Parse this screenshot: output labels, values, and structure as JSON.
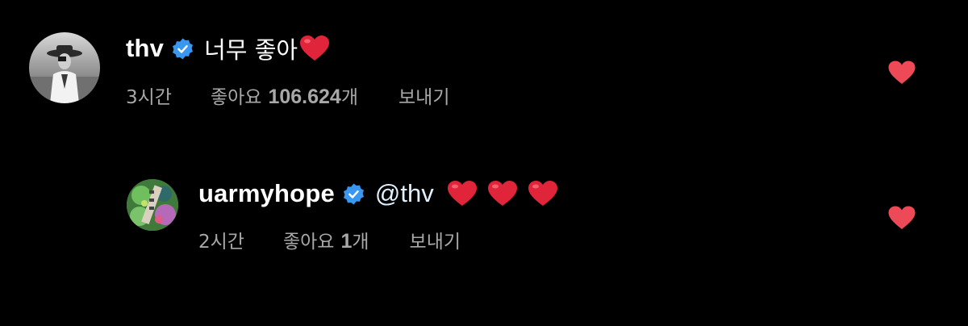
{
  "comments": [
    {
      "username": "thv",
      "text": "너무 좋아",
      "emoji": "red-heart",
      "time": "3시간",
      "likes_prefix": "좋아요",
      "likes_count": "106.624",
      "likes_suffix": "개",
      "reply_label": "보내기",
      "liked": true
    },
    {
      "username": "uarmyhope",
      "mention": "@thv",
      "emoji": "red-heart",
      "emoji_count": 3,
      "time": "2시간",
      "likes_prefix": "좋아요",
      "likes_count": "1",
      "likes_suffix": "개",
      "reply_label": "보내기",
      "liked": true
    }
  ],
  "colors": {
    "background": "#000000",
    "text": "#ffffff",
    "meta": "#a8a8a8",
    "verified": "#3897f0",
    "mention": "#e0f1ff",
    "like": "#ed4956",
    "heart_emoji": "#e0243a"
  }
}
